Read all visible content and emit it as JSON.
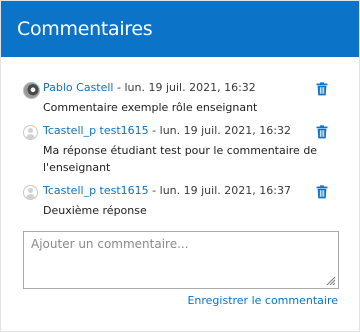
{
  "header": {
    "title": "Commentaires"
  },
  "comments": [
    {
      "author": "Pablo Castell",
      "date": "lun. 19 juil. 2021, 16:32",
      "text": "Commentaire exemple rôle enseignant",
      "avatar": "user-photo-avatar",
      "delete_icon": "trash-icon"
    },
    {
      "author": "Tcastell_p test1615",
      "date": "lun. 19 juil. 2021, 16:32",
      "text": "Ma réponse étudiant test pour le commentaire de l'enseignant",
      "avatar": "default-user-avatar",
      "delete_icon": "trash-icon"
    },
    {
      "author": "Tcastell_p test1615",
      "date": "lun. 19 juil. 2021, 16:37",
      "text": "Deuxième réponse",
      "avatar": "default-user-avatar",
      "delete_icon": "trash-icon"
    }
  ],
  "separator": " - ",
  "input": {
    "placeholder": "Ajouter un commentaire...",
    "value": ""
  },
  "save_label": "Enregistrer le commentaire",
  "colors": {
    "accent": "#0b73c8",
    "header_bg": "#0b73c8"
  }
}
